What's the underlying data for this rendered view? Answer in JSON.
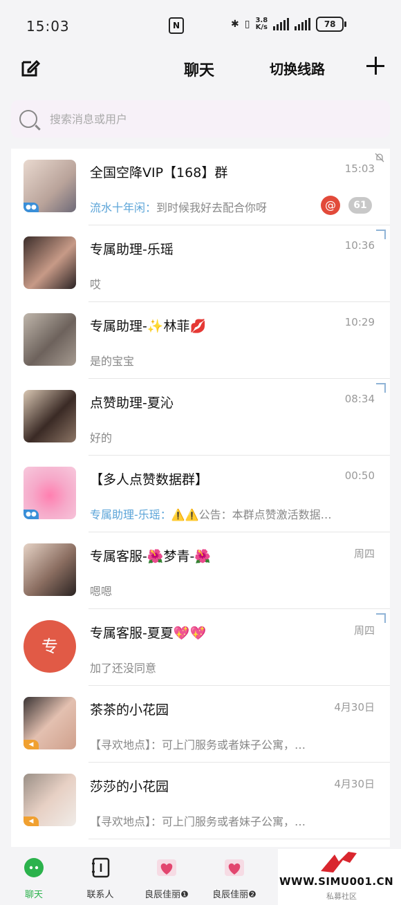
{
  "status_bar": {
    "time": "15:03",
    "net_speed_top": "3.8",
    "net_speed_unit": "K/s",
    "battery": "78"
  },
  "header": {
    "title": "聊天",
    "switch_route": "切换线路"
  },
  "search": {
    "placeholder": "搜索消息或用户"
  },
  "chats": [
    {
      "name": "全国空降VIP【168】群",
      "time": "15:03",
      "sender": "流水十年闲：",
      "message": "到时候我好去配合你呀",
      "at": "@",
      "unread": "61"
    },
    {
      "name": "专属助理-乐瑶",
      "time": "10:36",
      "sender": "",
      "message": "哎"
    },
    {
      "name": "专属助理-✨林菲💋",
      "time": "10:29",
      "sender": "",
      "message": "是的宝宝"
    },
    {
      "name": "点赞助理-夏沁",
      "time": "08:34",
      "sender": "",
      "message": "好的"
    },
    {
      "name": "【多人点赞数据群】",
      "time": "00:50",
      "sender": "专属助理-乐瑶：",
      "message": "⚠️⚠️公告：本群点赞激活数据…"
    },
    {
      "name": "专属客服-🌺梦青-🌺",
      "time": "周四",
      "sender": "",
      "message": "嗯嗯"
    },
    {
      "name": "专属客服-夏夏💖💖",
      "time": "周四",
      "sender": "",
      "message": "加了还没同意",
      "avatar_text": "专"
    },
    {
      "name": "茶茶的小花园",
      "time": "4月30日",
      "sender": "",
      "message": "【寻欢地点】：可上门服务或者妹子公寓，…"
    },
    {
      "name": "莎莎的小花园",
      "time": "4月30日",
      "sender": "",
      "message": "【寻欢地点】：可上门服务或者妹子公寓，…"
    }
  ],
  "tabs": [
    {
      "label": "聊天"
    },
    {
      "label": "联系人"
    },
    {
      "label": "良辰佳丽❶"
    },
    {
      "label": "良辰佳丽❷"
    }
  ],
  "watermark": {
    "site": "WWW.SIMU001.CN",
    "label": "私募社区"
  },
  "colors": {
    "accent_green": "#2bb24c",
    "sender_blue": "#5ba4d8",
    "badge_red": "#e24a3a"
  }
}
